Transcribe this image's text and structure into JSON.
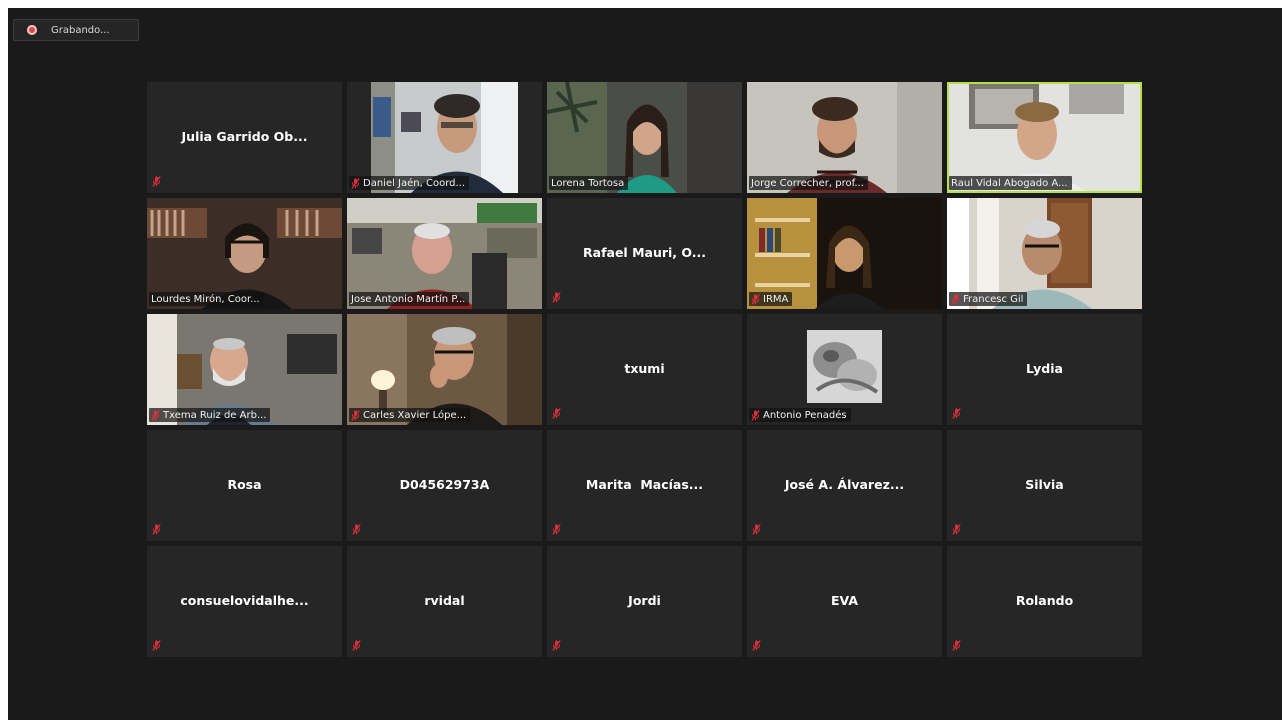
{
  "recording": {
    "label": "Grabando..."
  },
  "colors": {
    "active_speaker_border": "#b7e046",
    "mute_icon": "#e0303a",
    "tile_background": "#262626"
  },
  "participants": [
    {
      "name": "Julia Garrido Ob...",
      "video": false,
      "muted": true
    },
    {
      "name": "Daniel Jaén, Coord...",
      "video": true,
      "muted": true
    },
    {
      "name": "Lorena Tortosa",
      "video": true,
      "muted": false
    },
    {
      "name": "Jorge Correcher, prof...",
      "video": true,
      "muted": false
    },
    {
      "name": "Raul Vidal Abogado A...",
      "video": true,
      "muted": false,
      "active_speaker": true
    },
    {
      "name": "Lourdes Mirón, Coor...",
      "video": true,
      "muted": false
    },
    {
      "name": "Jose Antonio Martín P...",
      "video": true,
      "muted": false
    },
    {
      "name": "Rafael Mauri, O...",
      "video": false,
      "muted": true
    },
    {
      "name": "IRMA",
      "video": true,
      "muted": true
    },
    {
      "name": "Francesc Gil",
      "video": true,
      "muted": true
    },
    {
      "name": "Txema Ruiz de Arb...",
      "video": true,
      "muted": true
    },
    {
      "name": "Carles Xavier Lópe...",
      "video": true,
      "muted": true
    },
    {
      "name": "txumi",
      "video": false,
      "muted": true
    },
    {
      "name": "Antonio Penadés",
      "video": false,
      "avatar": true,
      "muted": true
    },
    {
      "name": "Lydia",
      "video": false,
      "muted": true
    },
    {
      "name": "Rosa",
      "video": false,
      "muted": true
    },
    {
      "name": "D04562973A",
      "video": false,
      "muted": true
    },
    {
      "name": "Marita  Macías...",
      "video": false,
      "muted": true
    },
    {
      "name": "José A. Álvarez...",
      "video": false,
      "muted": true
    },
    {
      "name": "Silvia",
      "video": false,
      "muted": true
    },
    {
      "name": "consuelovidalhe...",
      "video": false,
      "muted": true
    },
    {
      "name": "rvidal",
      "video": false,
      "muted": true
    },
    {
      "name": "Jordi",
      "video": false,
      "muted": true
    },
    {
      "name": "EVA",
      "video": false,
      "muted": true
    },
    {
      "name": "Rolando",
      "video": false,
      "muted": true
    }
  ]
}
